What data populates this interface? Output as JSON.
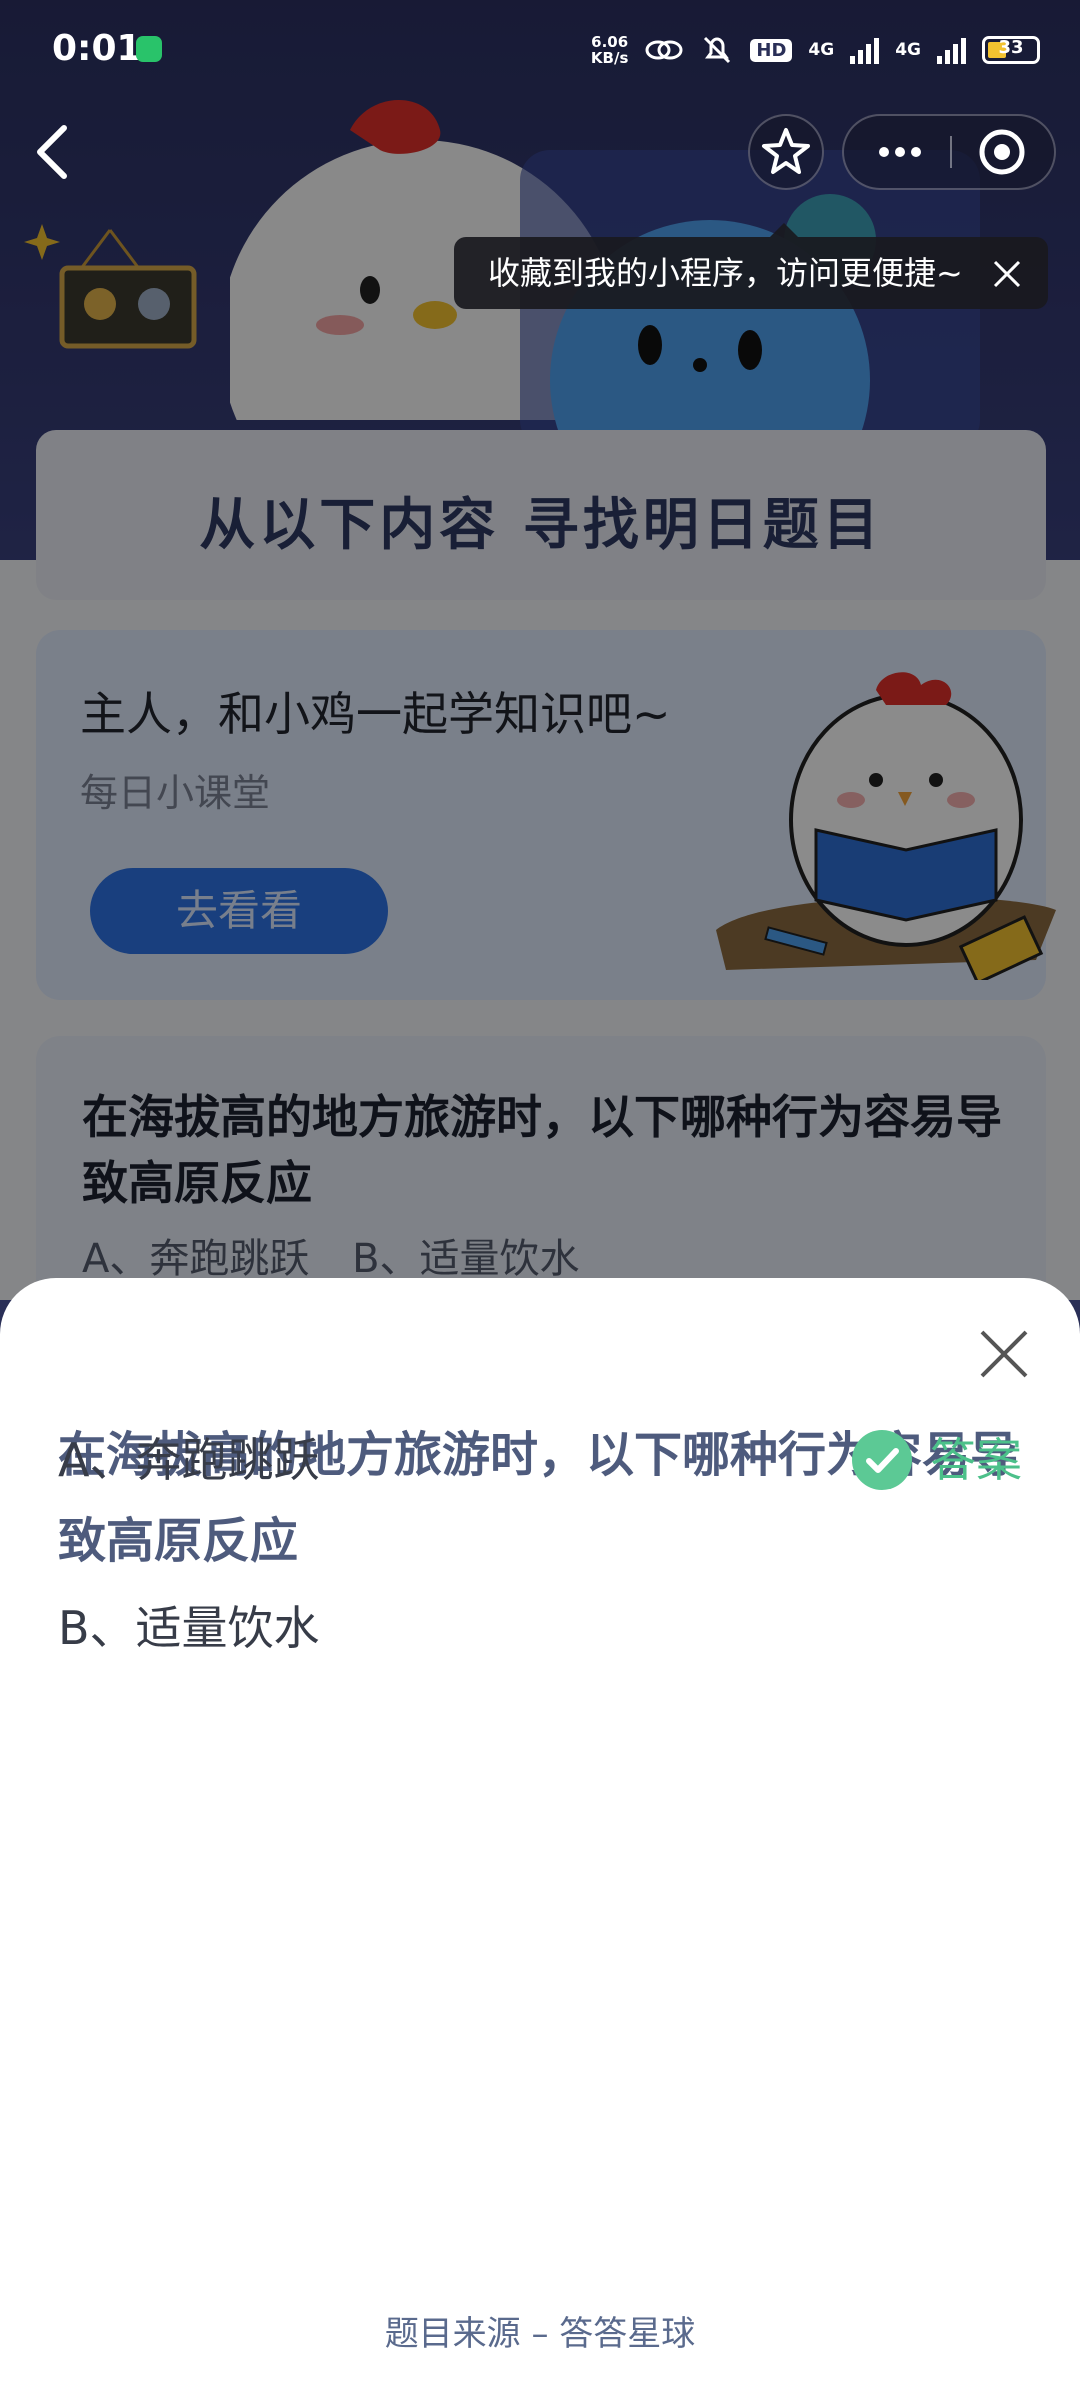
{
  "status_bar": {
    "time": "0:01",
    "net_speed_value": "6.06",
    "net_speed_unit": "KB/s",
    "hd_label": "HD",
    "network_1": "4G",
    "network_2": "4G",
    "battery_level": "33"
  },
  "tooltip": {
    "text": "收藏到我的小程序，访问更便捷~"
  },
  "hero": {
    "panel_title": "从以下内容  寻找明日题目"
  },
  "lesson_card": {
    "title": "主人，和小鸡一起学知识吧~",
    "subtitle": "每日小课堂",
    "button_label": "去看看"
  },
  "question_card": {
    "question": "在海拔高的地方旅游时，以下哪种行为容易导致高原反应",
    "options_preview": "A、奔跑跳跃 B、适量饮水"
  },
  "sheet": {
    "question": "在海拔高的地方旅游时，以下哪种行为容易导致高原反应",
    "option_a": "A、奔跑跳跃",
    "option_b": "B、适量饮水",
    "answer_label": "答案",
    "source": "题目来源 – 答答星球"
  },
  "colors": {
    "answer_green": "#5cc995",
    "question_blue": "#4e5b7d",
    "hero_navy": "#2c3162"
  }
}
